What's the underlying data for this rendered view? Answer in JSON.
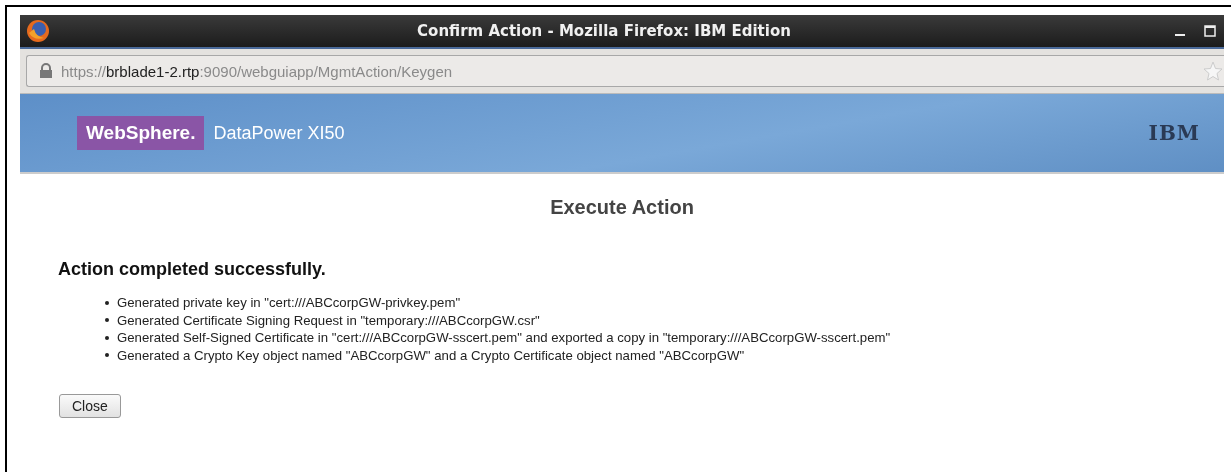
{
  "window": {
    "title": "Confirm Action - Mozilla Firefox: IBM Edition"
  },
  "address_bar": {
    "scheme": "https://",
    "host": "brblade1-2.rtp",
    "path": ":9090/webguiapp/MgmtAction/Keygen"
  },
  "banner": {
    "product_badge": "WebSphere.",
    "product_name": "DataPower XI50",
    "vendor_logo": "IBM"
  },
  "page": {
    "title": "Execute Action",
    "status": "Action completed successfully.",
    "results": [
      "Generated private key in \"cert:///ABCcorpGW-privkey.pem\"",
      "Generated Certificate Signing Request in \"temporary:///ABCcorpGW.csr\"",
      "Generated Self-Signed Certificate in \"cert:///ABCcorpGW-sscert.pem\" and exported a copy in \"temporary:///ABCcorpGW-sscert.pem\"",
      "Generated a Crypto Key object named \"ABCcorpGW\" and a Crypto Certificate object named \"ABCcorpGW\""
    ],
    "buttons": [
      "Close"
    ]
  }
}
